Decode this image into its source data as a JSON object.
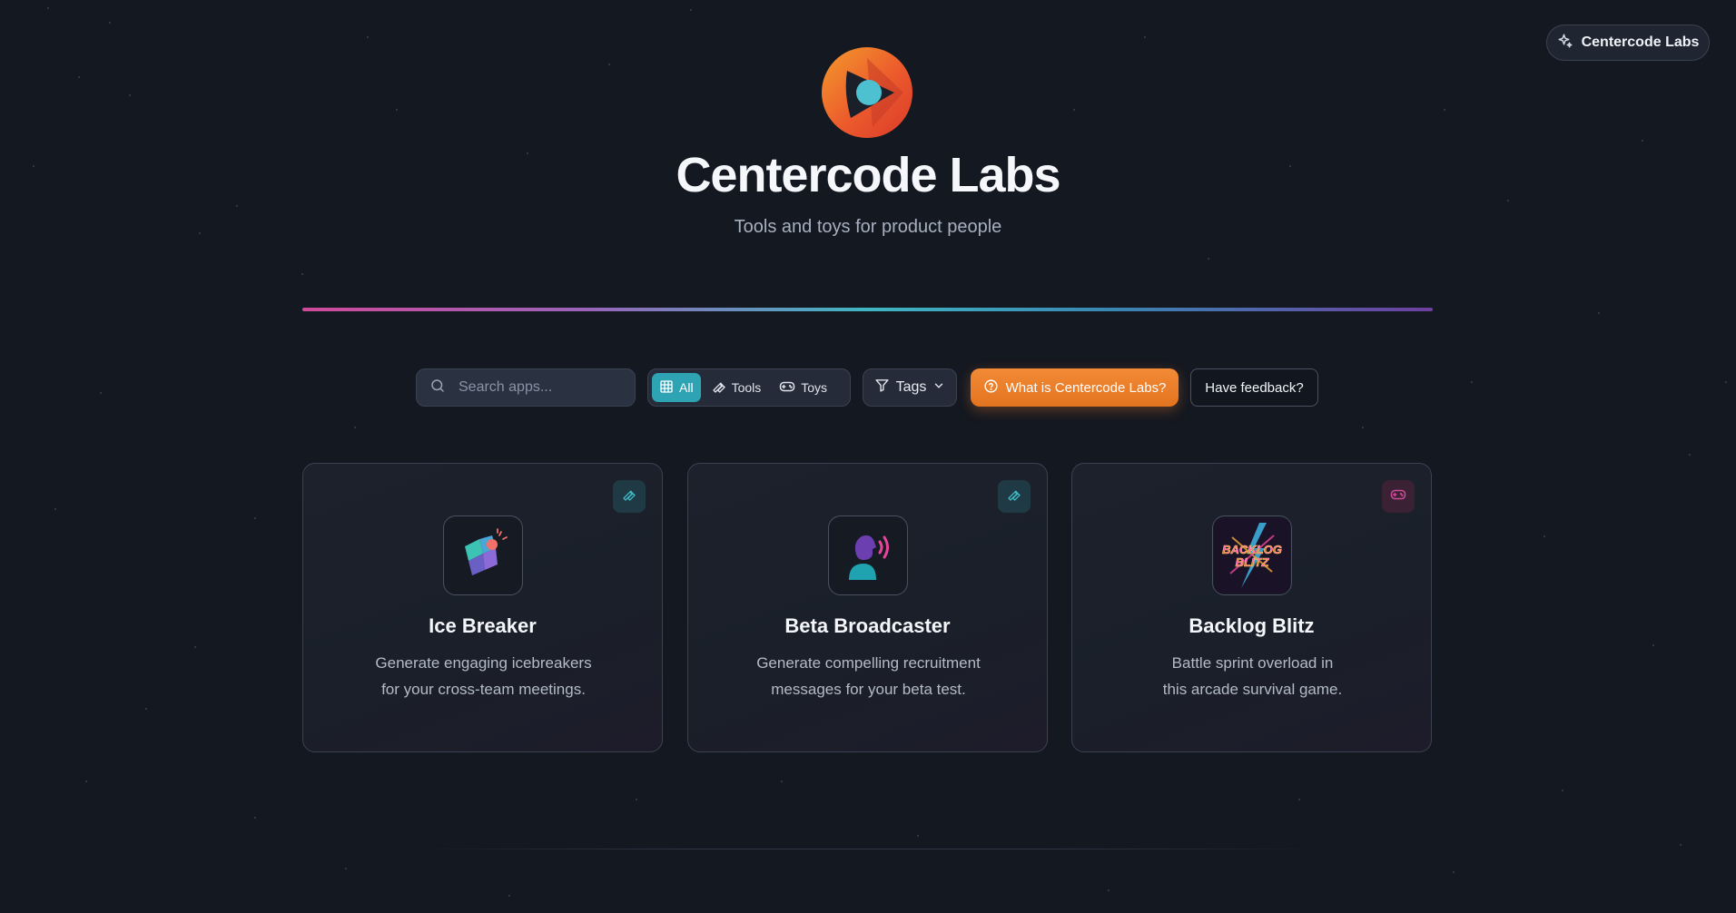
{
  "badge": {
    "label": "Centercode Labs",
    "icon": "sparkles-icon"
  },
  "hero": {
    "logo": "centercode-logo",
    "title": "Centercode Labs",
    "subtitle": "Tools and toys for product people"
  },
  "toolbar": {
    "search_placeholder": "Search apps...",
    "filters": [
      {
        "label": "All",
        "icon": "grid-icon",
        "active": true
      },
      {
        "label": "Tools",
        "icon": "wrench-icon",
        "active": false
      },
      {
        "label": "Toys",
        "icon": "gamepad-icon",
        "active": false
      }
    ],
    "tags_label": "Tags",
    "what_label": "What is Centercode Labs?",
    "feedback_label": "Have feedback?"
  },
  "apps": [
    {
      "title": "Ice Breaker",
      "desc_lines": [
        "Generate engaging icebreakers",
        "for your cross-team meetings."
      ],
      "type": "tool",
      "type_icon": "wrench-icon"
    },
    {
      "title": "Beta Broadcaster",
      "desc_lines": [
        "Generate compelling recruitment",
        "messages for your beta test."
      ],
      "type": "tool",
      "type_icon": "wrench-icon"
    },
    {
      "title": "Backlog Blitz",
      "desc_lines": [
        "Battle sprint overload in",
        "this arcade survival game."
      ],
      "type": "toy",
      "type_icon": "gamepad-icon",
      "logo_text": [
        "BACKLOG",
        "BLITZ"
      ]
    }
  ],
  "colors": {
    "background": "#141821",
    "accent_teal": "#2ea3b3",
    "accent_orange": "#f28a36",
    "toy_pink": "#d04a9b"
  }
}
